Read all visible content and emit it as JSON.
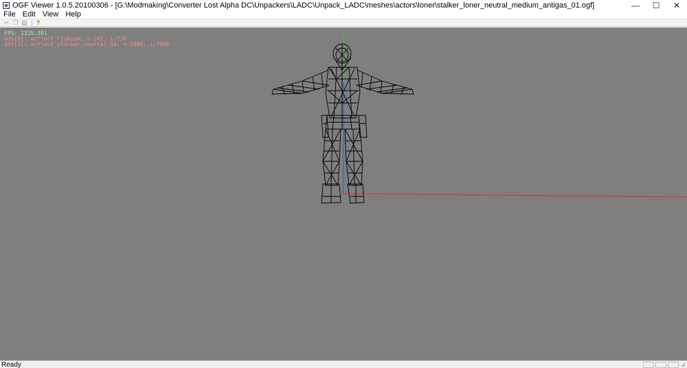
{
  "window": {
    "title": "OGF Viewer 1.0.5.20100306 - [G:\\Modmaking\\Converter Lost Alpha DC\\Unpackers\\LADC\\Unpack_LADC\\meshes\\actors\\loner\\stalker_loner_neutral_medium_antigas_01.ogf]",
    "minimize_glyph": "—",
    "maximize_glyph": "☐",
    "close_glyph": "✕"
  },
  "menu": {
    "items": [
      {
        "label": "File"
      },
      {
        "label": "Edit"
      },
      {
        "label": "View"
      },
      {
        "label": "Help"
      }
    ]
  },
  "toolbar": {
    "buttons": [
      {
        "icon": "cut-icon",
        "glyph": "✂"
      },
      {
        "icon": "copy-icon",
        "glyph": "❐"
      },
      {
        "icon": "paste-icon",
        "glyph": "▤"
      },
      {
        "icon": "help-icon",
        "glyph": "?"
      }
    ]
  },
  "viewport": {
    "background_color": "#7f7f7f",
    "wireframe_color": "#000000",
    "axis_colors": {
      "x": "#e03030",
      "y": "#2fbf3f",
      "z": "#3050e0"
    },
    "overlay": {
      "fps": "FPS: 1325.381",
      "dds_lines": [
        "dds[0]: act\\act_rjukzak, v:242, i:738",
        "dds[1]: act\\act_stalker_neutral_6a, v:2980, i:7806"
      ],
      "fps_color": "#9ff09f",
      "dds_color": "#ff8a8a"
    }
  },
  "status": {
    "text": "Ready"
  }
}
